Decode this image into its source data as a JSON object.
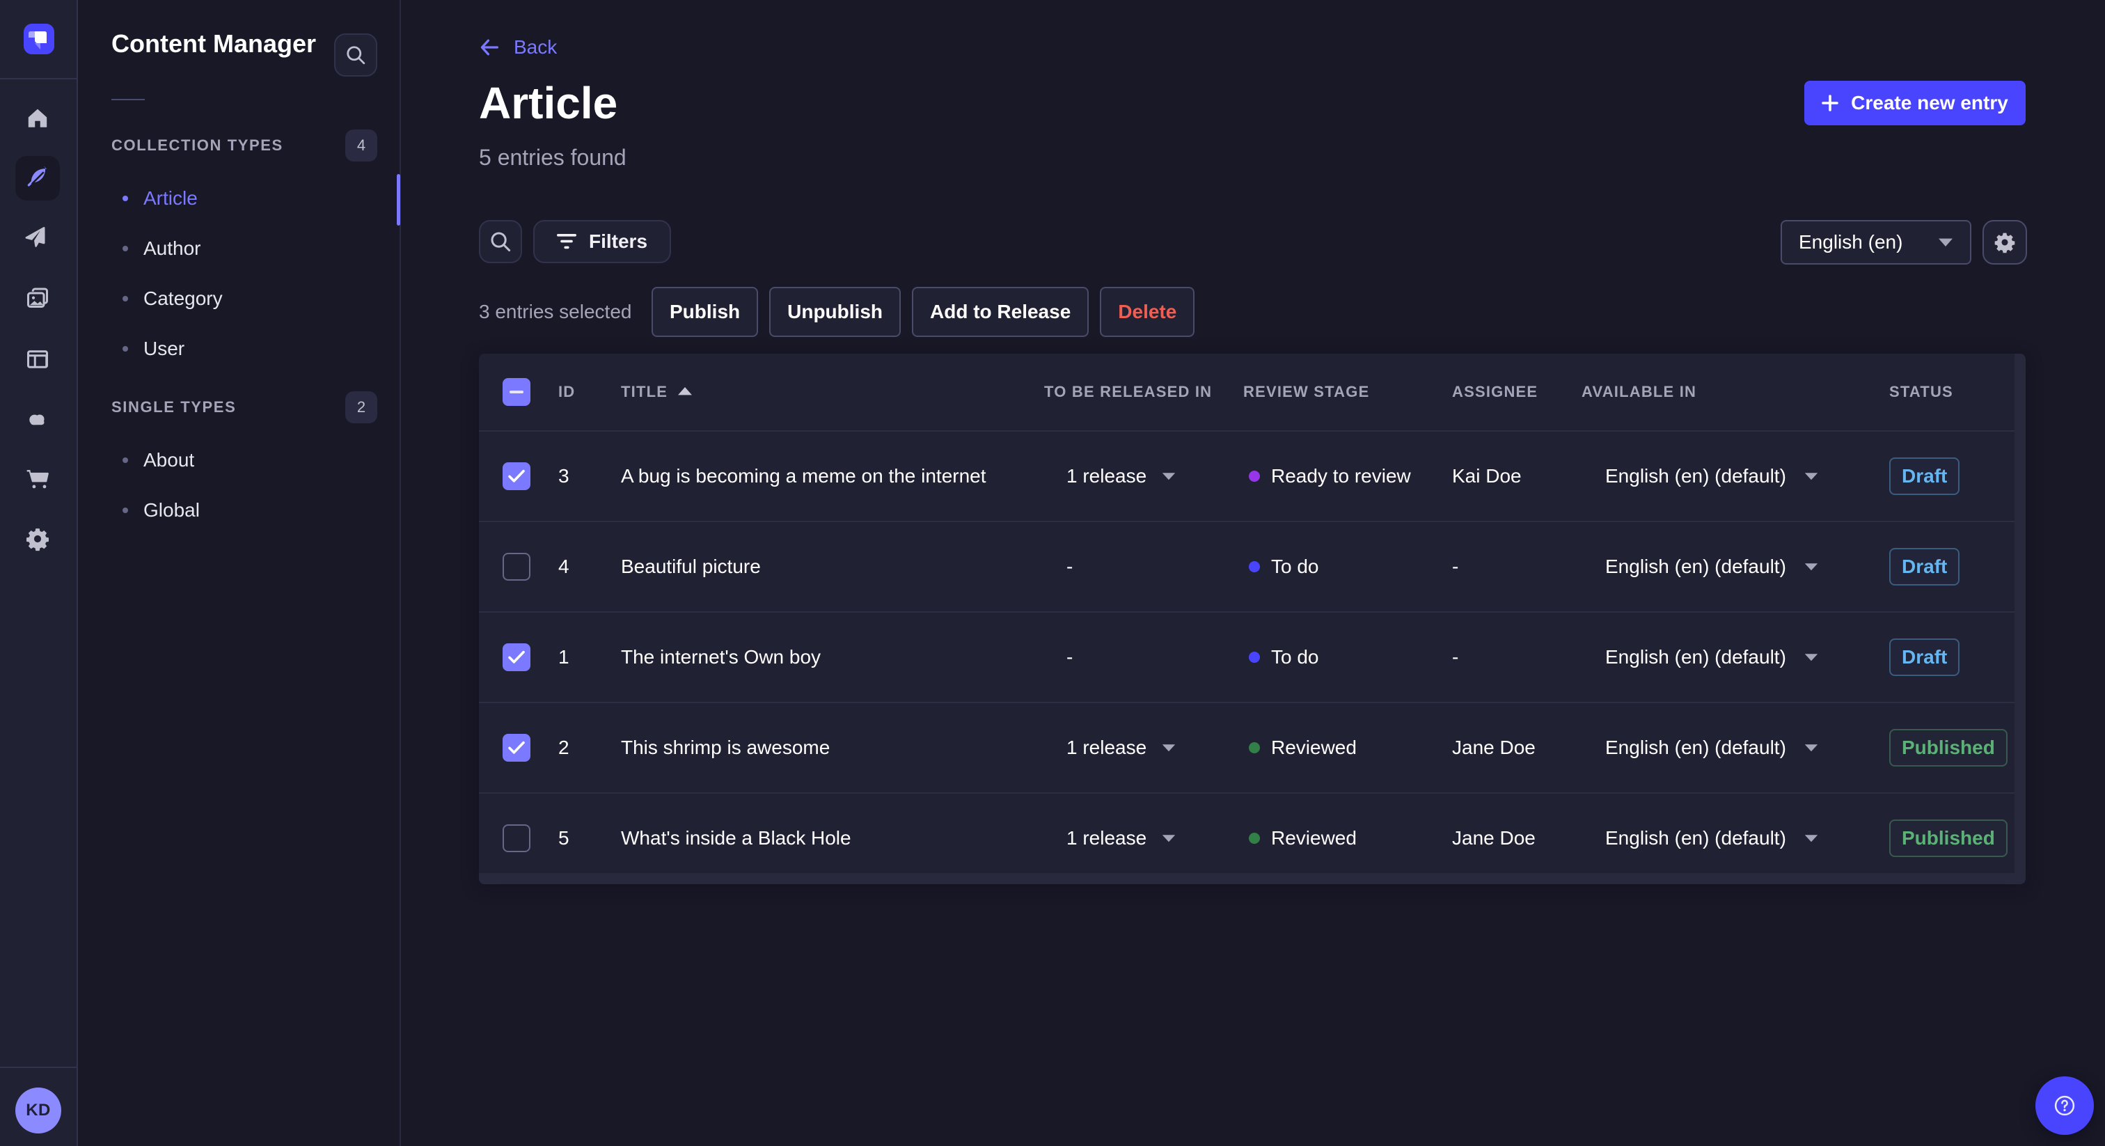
{
  "colors": {
    "app_background": "#181826",
    "surface": "#212134",
    "accent_button": "#4945ff",
    "accent_link": "#7b79ff",
    "checkbox_checked": "#7b79ff",
    "text_secondary": "#a5a5ba",
    "danger": "#ee5e52",
    "draft": "#66b7f1",
    "published": "#5cb176"
  },
  "rail": {
    "avatar_initials": "KD",
    "icons": [
      {
        "name": "home-icon",
        "active": false
      },
      {
        "name": "content-manager-feather-icon",
        "active": true
      },
      {
        "name": "release-paper-plane-icon",
        "active": false
      },
      {
        "name": "media-library-images-icon",
        "active": false
      },
      {
        "name": "content-type-builder-layout-icon",
        "active": false
      },
      {
        "name": "deploy-cloud-icon",
        "active": false
      },
      {
        "name": "marketplace-cart-icon",
        "active": false
      },
      {
        "name": "settings-gear-icon",
        "active": false
      }
    ]
  },
  "subnav": {
    "title": "Content Manager",
    "sections": [
      {
        "label": "COLLECTION TYPES",
        "badge": "4",
        "items": [
          {
            "label": "Article",
            "active": true
          },
          {
            "label": "Author",
            "active": false
          },
          {
            "label": "Category",
            "active": false
          },
          {
            "label": "User",
            "active": false
          }
        ]
      },
      {
        "label": "SINGLE TYPES",
        "badge": "2",
        "items": [
          {
            "label": "About",
            "active": false
          },
          {
            "label": "Global",
            "active": false
          }
        ]
      }
    ]
  },
  "header": {
    "back_label": "Back",
    "title": "Article",
    "entries_found": "5 entries found",
    "create_label": "Create new entry"
  },
  "toolbar": {
    "filters_label": "Filters",
    "locale_value": "English (en)"
  },
  "selection": {
    "label": "3 entries selected",
    "publish_label": "Publish",
    "unpublish_label": "Unpublish",
    "add_to_release_label": "Add to Release",
    "delete_label": "Delete"
  },
  "table": {
    "select_all_state": "indeterminate",
    "columns": [
      "ID",
      "TITLE",
      "TO BE RELEASED IN",
      "REVIEW STAGE",
      "ASSIGNEE",
      "AVAILABLE IN",
      "STATUS"
    ],
    "sorted_column": "TITLE",
    "sort_direction": "ascending",
    "rows": [
      {
        "check": "checked",
        "id": "3",
        "title": "A bug is becoming a meme on the internet",
        "release": "1 release",
        "release_caret": "true",
        "stage": "Ready to review",
        "stage_color": "#9736e8",
        "assignee": "Kai Doe",
        "locale": "English (en) (default)",
        "status": "Draft",
        "status_variant": "draft"
      },
      {
        "check": "unchecked",
        "id": "4",
        "title": "Beautiful picture",
        "release": "-",
        "release_caret": "false",
        "stage": "To do",
        "stage_color": "#4945ff",
        "assignee": "-",
        "locale": "English (en) (default)",
        "status": "Draft",
        "status_variant": "draft"
      },
      {
        "check": "checked",
        "id": "1",
        "title": "The internet's Own boy",
        "release": "-",
        "release_caret": "false",
        "stage": "To do",
        "stage_color": "#4945ff",
        "assignee": "-",
        "locale": "English (en) (default)",
        "status": "Draft",
        "status_variant": "draft"
      },
      {
        "check": "checked",
        "id": "2",
        "title": "This shrimp is awesome",
        "release": "1 release",
        "release_caret": "true",
        "stage": "Reviewed",
        "stage_color": "#328048",
        "assignee": "Jane Doe",
        "locale": "English (en) (default)",
        "status": "Published",
        "status_variant": "published"
      },
      {
        "check": "unchecked",
        "id": "5",
        "title": "What's inside a Black Hole",
        "release": "1 release",
        "release_caret": "true",
        "stage": "Reviewed",
        "stage_color": "#328048",
        "assignee": "Jane Doe",
        "locale": "English (en) (default)",
        "status": "Published",
        "status_variant": "published"
      }
    ]
  },
  "help": {
    "icon": "question-circle-icon"
  }
}
